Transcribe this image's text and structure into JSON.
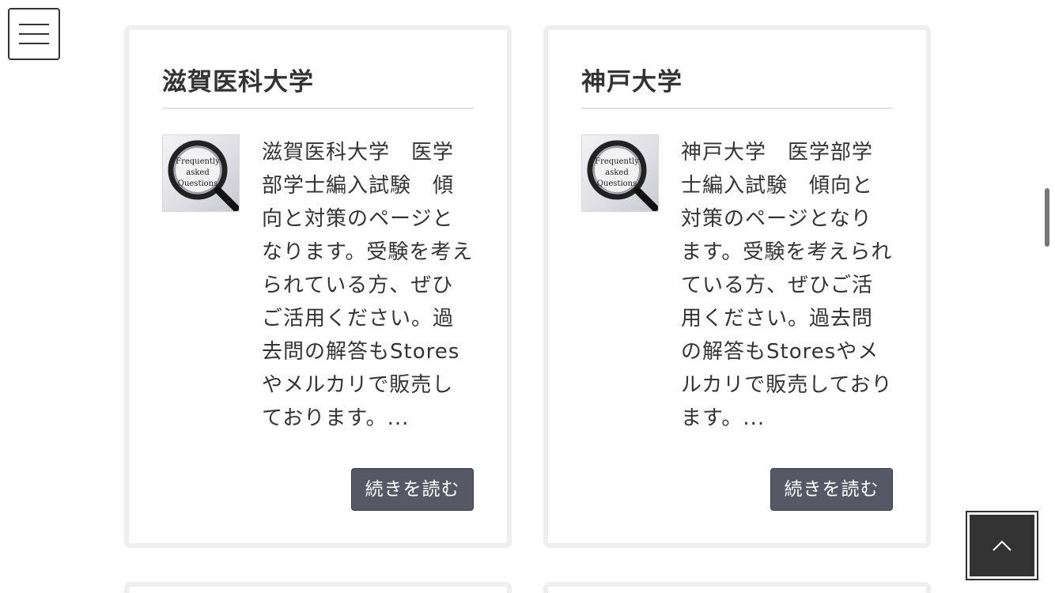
{
  "menu": {
    "icon": "hamburger-menu-icon"
  },
  "cards": [
    {
      "title": "滋賀医科大学",
      "thumbnail": {
        "icon": "magnifier-faq-icon",
        "line1": "Frequently",
        "line2": "asked",
        "line3": "Questions"
      },
      "excerpt": "滋賀医科大学　医学部学士編入試験　傾向と対策のページとなります。受験を考えられている方、ぜひご活用ください。過去問の解答もStoresやメルカリで販売しております。...",
      "button_label": "続きを読む"
    },
    {
      "title": "神戸大学",
      "thumbnail": {
        "icon": "magnifier-faq-icon",
        "line1": "Frequently",
        "line2": "asked",
        "line3": "Questions"
      },
      "excerpt": "神戸大学　医学部学士編入試験　傾向と対策のページとなります。受験を考えられている方、ぜひご活用ください。過去問の解答もStoresやメルカリで販売しております。...",
      "button_label": "続きを読む"
    }
  ],
  "back_to_top": {
    "icon": "chevron-up-icon"
  },
  "colors": {
    "button_bg": "#575766",
    "card_border": "#eeeeee",
    "text": "#333333",
    "back_to_top_bg": "#333333"
  }
}
